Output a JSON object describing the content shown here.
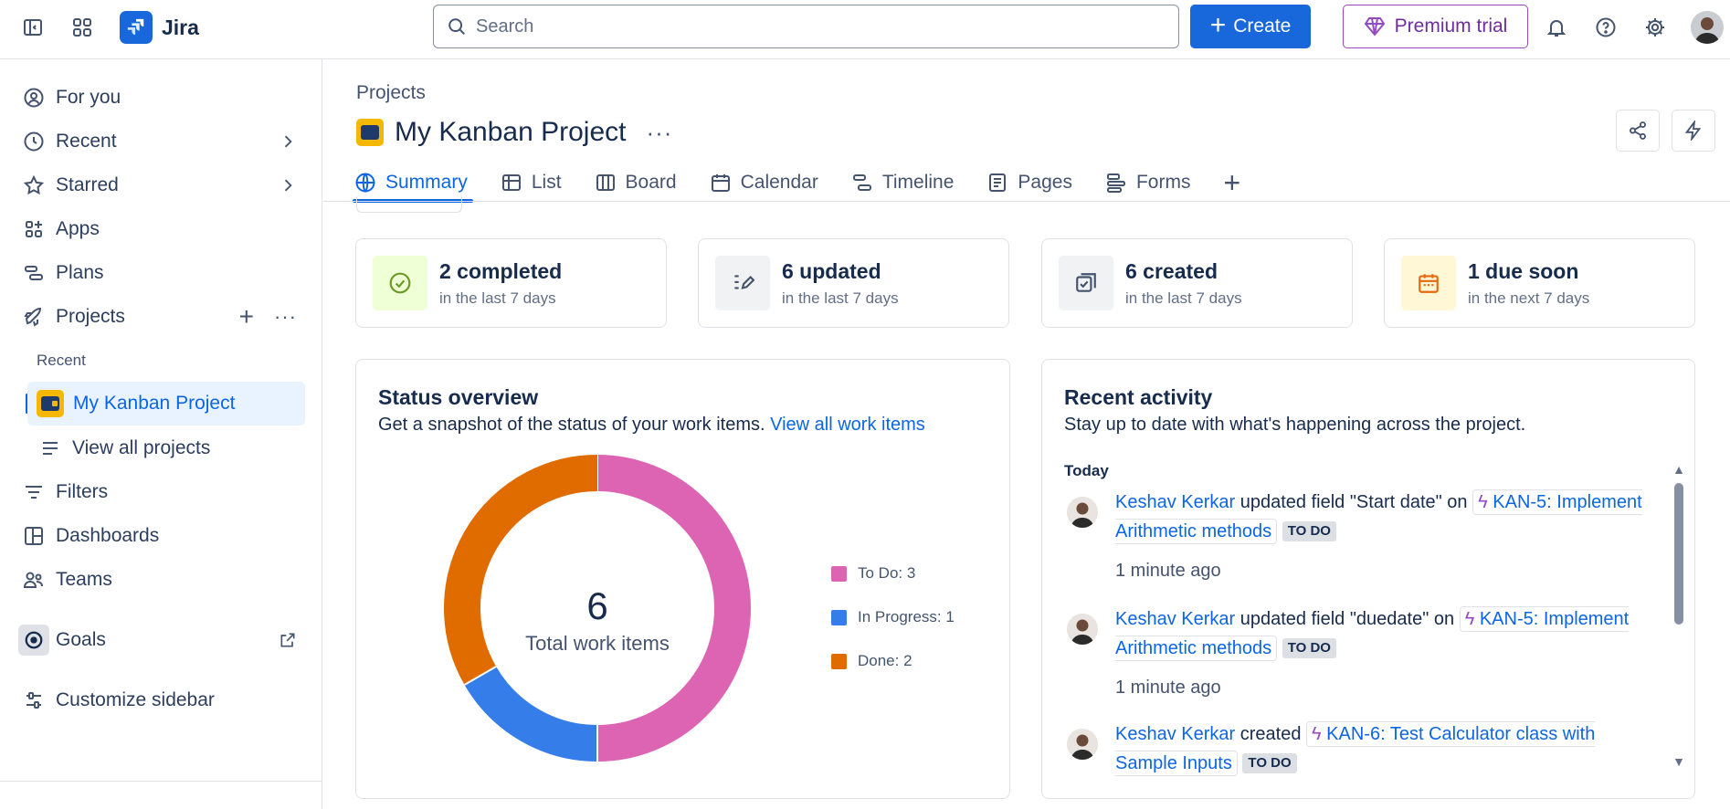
{
  "topbar": {
    "app_name": "Jira",
    "search_placeholder": "Search",
    "create_label": "Create",
    "premium_label": "Premium trial"
  },
  "sidebar": {
    "for_you": "For you",
    "recent": "Recent",
    "starred": "Starred",
    "apps": "Apps",
    "plans": "Plans",
    "projects": "Projects",
    "recent_header": "Recent",
    "active_project": "My Kanban Project",
    "view_all_projects": "View all projects",
    "filters": "Filters",
    "dashboards": "Dashboards",
    "teams": "Teams",
    "goals": "Goals",
    "customize": "Customize sidebar"
  },
  "header": {
    "breadcrumb": "Projects",
    "project_title": "My Kanban Project",
    "more": "···"
  },
  "tabs": [
    {
      "label": "Summary",
      "icon": "globe-icon",
      "active": true
    },
    {
      "label": "List",
      "icon": "list-icon"
    },
    {
      "label": "Board",
      "icon": "board-icon"
    },
    {
      "label": "Calendar",
      "icon": "calendar-icon"
    },
    {
      "label": "Timeline",
      "icon": "timeline-icon"
    },
    {
      "label": "Pages",
      "icon": "pages-icon"
    },
    {
      "label": "Forms",
      "icon": "forms-icon"
    }
  ],
  "stats": [
    {
      "main": "2 completed",
      "sub": "in the last 7 days",
      "icon": "check-circle-icon",
      "bg": "#efffd6",
      "color": "#6a9a23"
    },
    {
      "main": "6 updated",
      "sub": "in the last 7 days",
      "icon": "edit-icon",
      "bg": "#f1f2f4",
      "color": "#44546f"
    },
    {
      "main": "6 created",
      "sub": "in the last 7 days",
      "icon": "created-icon",
      "bg": "#f1f2f4",
      "color": "#44546f"
    },
    {
      "main": "1 due soon",
      "sub": "in the next 7 days",
      "icon": "calendar-icon",
      "bg": "#fff7d6",
      "color": "#e56910"
    }
  ],
  "status_overview": {
    "title": "Status overview",
    "description": "Get a snapshot of the status of your work items.",
    "link": "View all work items",
    "total": "6",
    "total_label": "Total work items",
    "legend": [
      {
        "label": "To Do: 3",
        "value": 3,
        "color": "#dd64b3"
      },
      {
        "label": "In Progress: 1",
        "value": 1,
        "color": "#357de8"
      },
      {
        "label": "Done: 2",
        "value": 2,
        "color": "#e06c00"
      }
    ]
  },
  "recent_activity": {
    "title": "Recent activity",
    "description": "Stay up to date with what's happening across the project.",
    "group": "Today",
    "items": [
      {
        "user": "Keshav Kerkar",
        "action": " updated field \"Start date\" on ",
        "link": "KAN-5: Implement Arithmetic methods",
        "status": "TO DO",
        "time": "1 minute ago"
      },
      {
        "user": "Keshav Kerkar",
        "action": " updated field \"duedate\" on ",
        "link": "KAN-5: Implement Arithmetic methods",
        "status": "TO DO",
        "time": "1 minute ago"
      },
      {
        "user": "Keshav Kerkar",
        "action": " created ",
        "link": "KAN-6: Test Calculator class with Sample Inputs",
        "status": "TO DO",
        "time": ""
      }
    ]
  }
}
